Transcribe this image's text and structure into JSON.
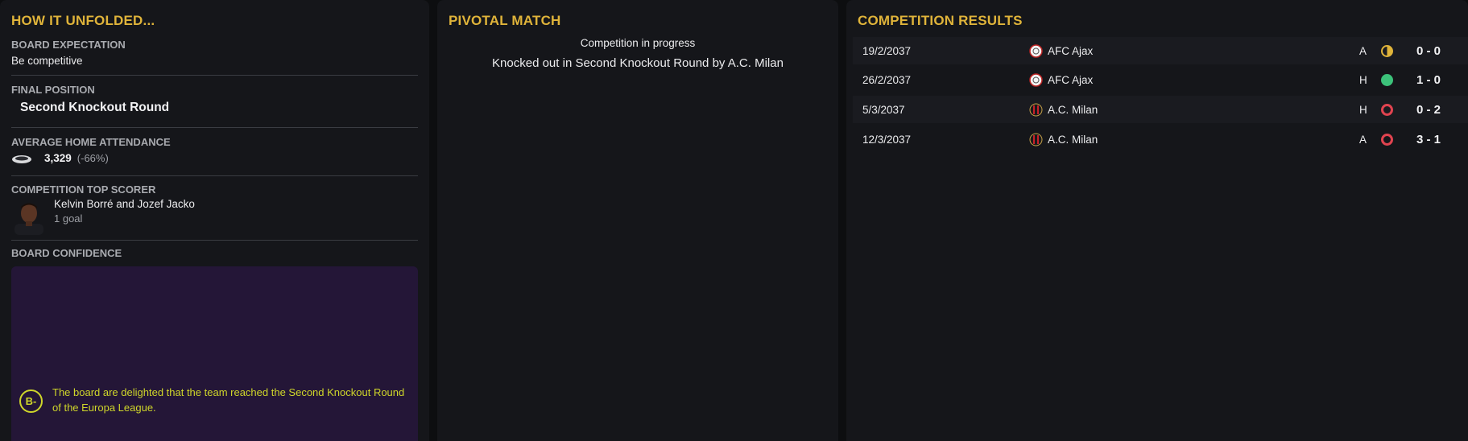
{
  "left": {
    "title": "HOW IT UNFOLDED...",
    "board_expectation_label": "BOARD EXPECTATION",
    "board_expectation_value": "Be competitive",
    "final_position_label": "FINAL POSITION",
    "final_position_value": "Second Knockout Round",
    "attendance_label": "AVERAGE HOME ATTENDANCE",
    "attendance_value": "3,329",
    "attendance_change": "(-66%)",
    "top_scorer_label": "COMPETITION TOP SCORER",
    "top_scorer_names": "Kelvin Borré and Jozef Jacko",
    "top_scorer_goals": "1 goal",
    "board_confidence_label": "BOARD CONFIDENCE",
    "confidence_grade": "B-",
    "confidence_text": "The board are delighted that the team reached the Second Knockout Round of the Europa League."
  },
  "middle": {
    "title": "PIVOTAL MATCH",
    "status": "Competition in progress",
    "knocked_out": "Knocked out in Second Knockout Round by A.C. Milan"
  },
  "right": {
    "title": "COMPETITION RESULTS",
    "results": [
      {
        "date": "19/2/2037",
        "team": "AFC Ajax",
        "crest": "ajax-crest-icon",
        "venue": "A",
        "outcome": "draw",
        "score": "0 - 0"
      },
      {
        "date": "26/2/2037",
        "team": "AFC Ajax",
        "crest": "ajax-crest-icon",
        "venue": "H",
        "outcome": "win",
        "score": "1 - 0"
      },
      {
        "date": "5/3/2037",
        "team": "A.C. Milan",
        "crest": "milan-crest-icon",
        "venue": "H",
        "outcome": "loss",
        "score": "0 - 2"
      },
      {
        "date": "12/3/2037",
        "team": "A.C. Milan",
        "crest": "milan-crest-icon",
        "venue": "A",
        "outcome": "loss",
        "score": "3 - 1"
      }
    ]
  },
  "colors": {
    "accent_gold": "#e0b43a",
    "grade_yellow": "#cfd62a",
    "confidence_bg": "#241637",
    "win": "#3cc27a",
    "loss": "#e0434f"
  }
}
